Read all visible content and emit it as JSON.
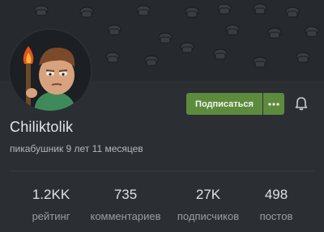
{
  "profile": {
    "username": "Chiliktolik",
    "tenure": "пикабушник 9 лет 11 месяцев"
  },
  "actions": {
    "subscribe_label": "Подписаться",
    "more_icon": "ellipsis-icon",
    "bell_icon": "bell-icon"
  },
  "stats": [
    {
      "value": "1.2KK",
      "label": "рейтинг"
    },
    {
      "value": "735",
      "label": "комментариев"
    },
    {
      "value": "27K",
      "label": "подписчиков"
    },
    {
      "value": "498",
      "label": "постов"
    }
  ],
  "colors": {
    "background": "#2b2e33",
    "cover": "#26292d",
    "accent": "#5d8b3e"
  }
}
